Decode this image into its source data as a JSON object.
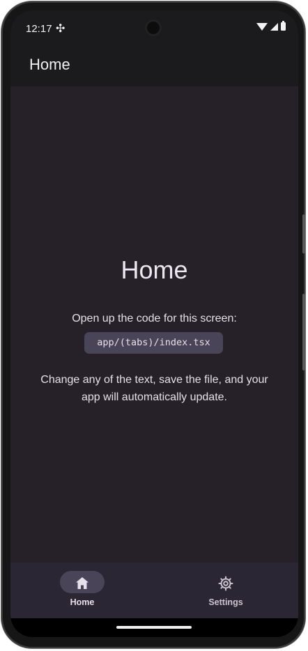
{
  "status": {
    "time": "12:17"
  },
  "appbar": {
    "title": "Home"
  },
  "main": {
    "heading": "Home",
    "intro": "Open up the code for this screen:",
    "code_path": "app/(tabs)/index.tsx",
    "body": "Change any of the text, save the file, and your app will automatically update."
  },
  "tabs": [
    {
      "label": "Home",
      "icon": "home-icon",
      "selected": true
    },
    {
      "label": "Settings",
      "icon": "gear-icon",
      "selected": false
    }
  ],
  "colors": {
    "background": "#262129",
    "appbar": "#1b1b1d",
    "tabbar": "#2b2633",
    "active_pill": "#4a4458",
    "code_box": "#4a4458"
  }
}
